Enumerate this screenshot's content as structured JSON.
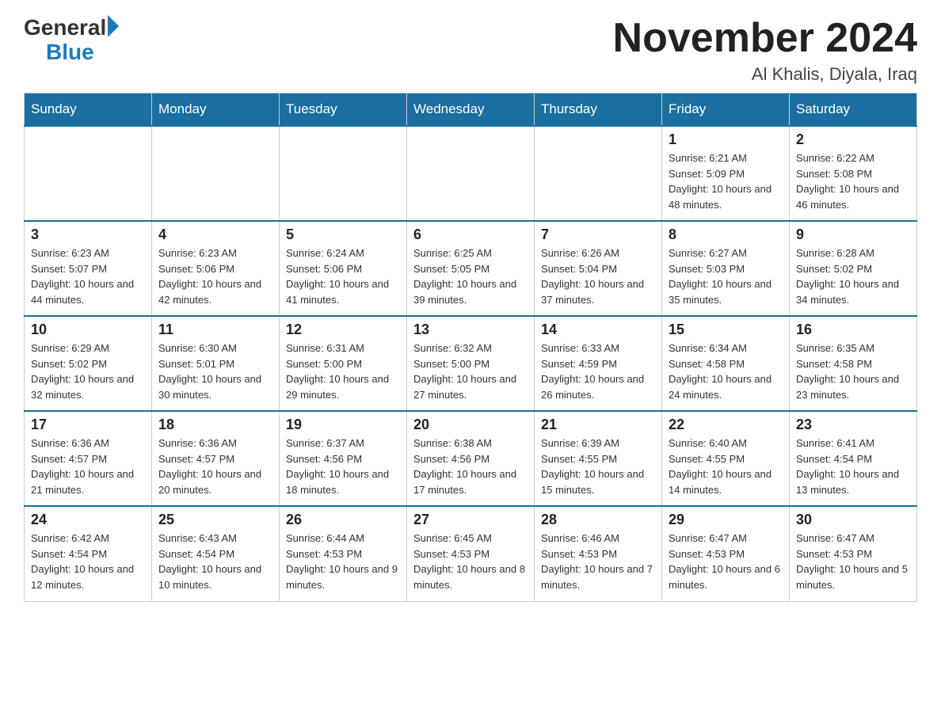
{
  "header": {
    "logo_general": "General",
    "logo_blue": "Blue",
    "month_title": "November 2024",
    "location": "Al Khalis, Diyala, Iraq"
  },
  "weekdays": [
    "Sunday",
    "Monday",
    "Tuesday",
    "Wednesday",
    "Thursday",
    "Friday",
    "Saturday"
  ],
  "weeks": [
    [
      {
        "day": "",
        "info": ""
      },
      {
        "day": "",
        "info": ""
      },
      {
        "day": "",
        "info": ""
      },
      {
        "day": "",
        "info": ""
      },
      {
        "day": "",
        "info": ""
      },
      {
        "day": "1",
        "info": "Sunrise: 6:21 AM\nSunset: 5:09 PM\nDaylight: 10 hours and 48 minutes."
      },
      {
        "day": "2",
        "info": "Sunrise: 6:22 AM\nSunset: 5:08 PM\nDaylight: 10 hours and 46 minutes."
      }
    ],
    [
      {
        "day": "3",
        "info": "Sunrise: 6:23 AM\nSunset: 5:07 PM\nDaylight: 10 hours and 44 minutes."
      },
      {
        "day": "4",
        "info": "Sunrise: 6:23 AM\nSunset: 5:06 PM\nDaylight: 10 hours and 42 minutes."
      },
      {
        "day": "5",
        "info": "Sunrise: 6:24 AM\nSunset: 5:06 PM\nDaylight: 10 hours and 41 minutes."
      },
      {
        "day": "6",
        "info": "Sunrise: 6:25 AM\nSunset: 5:05 PM\nDaylight: 10 hours and 39 minutes."
      },
      {
        "day": "7",
        "info": "Sunrise: 6:26 AM\nSunset: 5:04 PM\nDaylight: 10 hours and 37 minutes."
      },
      {
        "day": "8",
        "info": "Sunrise: 6:27 AM\nSunset: 5:03 PM\nDaylight: 10 hours and 35 minutes."
      },
      {
        "day": "9",
        "info": "Sunrise: 6:28 AM\nSunset: 5:02 PM\nDaylight: 10 hours and 34 minutes."
      }
    ],
    [
      {
        "day": "10",
        "info": "Sunrise: 6:29 AM\nSunset: 5:02 PM\nDaylight: 10 hours and 32 minutes."
      },
      {
        "day": "11",
        "info": "Sunrise: 6:30 AM\nSunset: 5:01 PM\nDaylight: 10 hours and 30 minutes."
      },
      {
        "day": "12",
        "info": "Sunrise: 6:31 AM\nSunset: 5:00 PM\nDaylight: 10 hours and 29 minutes."
      },
      {
        "day": "13",
        "info": "Sunrise: 6:32 AM\nSunset: 5:00 PM\nDaylight: 10 hours and 27 minutes."
      },
      {
        "day": "14",
        "info": "Sunrise: 6:33 AM\nSunset: 4:59 PM\nDaylight: 10 hours and 26 minutes."
      },
      {
        "day": "15",
        "info": "Sunrise: 6:34 AM\nSunset: 4:58 PM\nDaylight: 10 hours and 24 minutes."
      },
      {
        "day": "16",
        "info": "Sunrise: 6:35 AM\nSunset: 4:58 PM\nDaylight: 10 hours and 23 minutes."
      }
    ],
    [
      {
        "day": "17",
        "info": "Sunrise: 6:36 AM\nSunset: 4:57 PM\nDaylight: 10 hours and 21 minutes."
      },
      {
        "day": "18",
        "info": "Sunrise: 6:36 AM\nSunset: 4:57 PM\nDaylight: 10 hours and 20 minutes."
      },
      {
        "day": "19",
        "info": "Sunrise: 6:37 AM\nSunset: 4:56 PM\nDaylight: 10 hours and 18 minutes."
      },
      {
        "day": "20",
        "info": "Sunrise: 6:38 AM\nSunset: 4:56 PM\nDaylight: 10 hours and 17 minutes."
      },
      {
        "day": "21",
        "info": "Sunrise: 6:39 AM\nSunset: 4:55 PM\nDaylight: 10 hours and 15 minutes."
      },
      {
        "day": "22",
        "info": "Sunrise: 6:40 AM\nSunset: 4:55 PM\nDaylight: 10 hours and 14 minutes."
      },
      {
        "day": "23",
        "info": "Sunrise: 6:41 AM\nSunset: 4:54 PM\nDaylight: 10 hours and 13 minutes."
      }
    ],
    [
      {
        "day": "24",
        "info": "Sunrise: 6:42 AM\nSunset: 4:54 PM\nDaylight: 10 hours and 12 minutes."
      },
      {
        "day": "25",
        "info": "Sunrise: 6:43 AM\nSunset: 4:54 PM\nDaylight: 10 hours and 10 minutes."
      },
      {
        "day": "26",
        "info": "Sunrise: 6:44 AM\nSunset: 4:53 PM\nDaylight: 10 hours and 9 minutes."
      },
      {
        "day": "27",
        "info": "Sunrise: 6:45 AM\nSunset: 4:53 PM\nDaylight: 10 hours and 8 minutes."
      },
      {
        "day": "28",
        "info": "Sunrise: 6:46 AM\nSunset: 4:53 PM\nDaylight: 10 hours and 7 minutes."
      },
      {
        "day": "29",
        "info": "Sunrise: 6:47 AM\nSunset: 4:53 PM\nDaylight: 10 hours and 6 minutes."
      },
      {
        "day": "30",
        "info": "Sunrise: 6:47 AM\nSunset: 4:53 PM\nDaylight: 10 hours and 5 minutes."
      }
    ]
  ]
}
